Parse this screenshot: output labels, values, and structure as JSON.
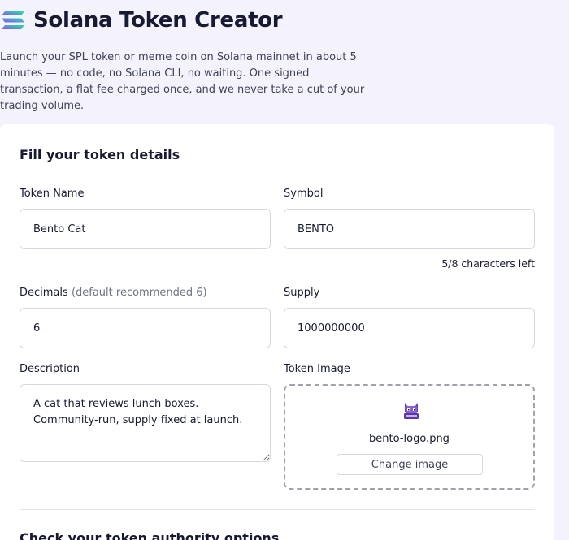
{
  "app": {
    "title": "Solana Token Creator",
    "intro": "Launch your SPL token or meme coin on Solana mainnet in about 5 minutes — no code, no Solana CLI, no waiting. One signed transaction, a flat fee charged once, and we never take a cut of your trading volume."
  },
  "form": {
    "section_title": "Fill your token details",
    "token_name": {
      "label": "Token Name",
      "value": "Bento Cat"
    },
    "symbol": {
      "label": "Symbol",
      "value": "BENTO",
      "counter": "5/8 characters left"
    },
    "decimals": {
      "label": "Decimals",
      "hint": "(default recommended 6)",
      "value": "6"
    },
    "supply": {
      "label": "Supply",
      "value": "1000000000"
    },
    "description": {
      "label": "Description",
      "value": "A cat that reviews lunch boxes. Community-run, supply fixed at launch."
    },
    "token_image": {
      "label": "Token Image",
      "filename": "bento-logo.png",
      "change_label": "Change image"
    }
  },
  "authority": {
    "section_title": "Check your token authority options"
  },
  "colors": {
    "brand_text": "#161a33",
    "page_bg": "#f4f2fc",
    "logo_gradient": [
      "#9945ff",
      "#14f195"
    ]
  }
}
